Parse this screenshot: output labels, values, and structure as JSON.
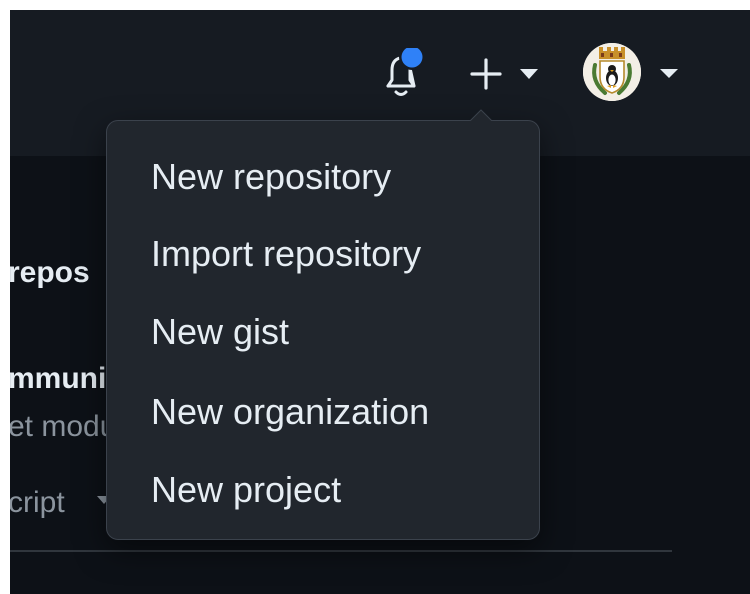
{
  "header": {
    "notifications": {
      "icon": "bell-icon",
      "unread_dot_color": "#2f81f7"
    },
    "create_menu": {
      "icon": "plus-icon",
      "caret_icon": "caret-down-icon"
    },
    "user_menu": {
      "avatar_icon": "avatar-coat-of-arms",
      "caret_icon": "caret-down-icon"
    }
  },
  "create_dropdown": {
    "items": [
      {
        "label": "New repository"
      },
      {
        "label": "Import repository"
      },
      {
        "label": "New gist"
      },
      {
        "label": "New organization"
      },
      {
        "label": "New project"
      }
    ]
  },
  "background": {
    "repo_heading_fragment": "repos",
    "community_fragment": "mmunit",
    "module_fragment": "et modu",
    "language_fragment": "cript"
  },
  "colors": {
    "header_bg": "#161b22",
    "page_bg": "#0d1117",
    "menu_bg": "#21262d",
    "menu_text": "#e6edf3",
    "muted_text": "#8b949e",
    "accent_blue": "#2f81f7"
  }
}
